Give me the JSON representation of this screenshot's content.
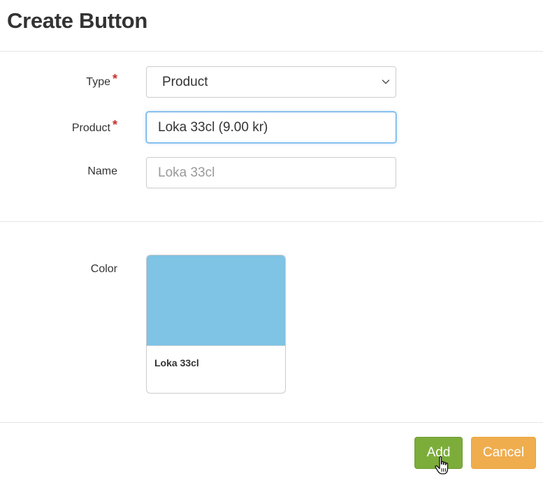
{
  "modal": {
    "title": "Create Button"
  },
  "form": {
    "type": {
      "label": "Type",
      "required_mark": "*",
      "value": "Product"
    },
    "product": {
      "label": "Product",
      "required_mark": "*",
      "value": "Loka 33cl (9.00 kr)"
    },
    "name": {
      "label": "Name",
      "value": "",
      "placeholder": "Loka 33cl"
    },
    "color": {
      "label": "Color",
      "swatch_color": "#7fc3e5",
      "preview_label": "Loka 33cl"
    }
  },
  "footer": {
    "add_label": "Add",
    "cancel_label": "Cancel"
  },
  "icons": {
    "select_arrow": "chevron-down-icon",
    "pointer": "hand-pointer-icon"
  },
  "colors": {
    "add_button": "#7cad3a",
    "cancel_button": "#f0ad4e",
    "required": "#c9302c",
    "focus": "#66afe9"
  }
}
